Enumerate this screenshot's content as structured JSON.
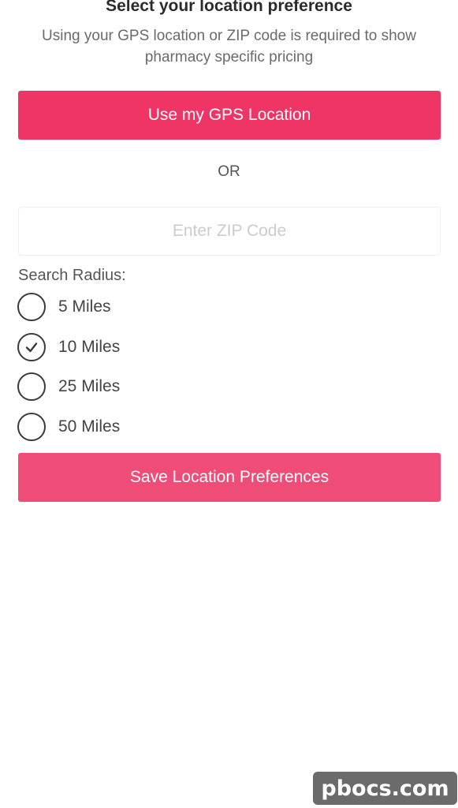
{
  "header": {
    "title": "Select your location preference",
    "subtitle": "Using your GPS location or ZIP code is required to show pharmacy specific pricing"
  },
  "gps_button": {
    "label": "Use my GPS Location",
    "color": "#ee3566"
  },
  "divider_text": "OR",
  "zip": {
    "value": "",
    "placeholder": "Enter ZIP Code"
  },
  "radius": {
    "label": "Search Radius:",
    "options": [
      {
        "label": "5 Miles",
        "selected": false
      },
      {
        "label": "10 Miles",
        "selected": true
      },
      {
        "label": "25 Miles",
        "selected": false
      },
      {
        "label": "50 Miles",
        "selected": false
      }
    ]
  },
  "save_button": {
    "label": "Save Location Preferences",
    "color": "#f04c78"
  },
  "watermark": {
    "text": "pbocs.com"
  }
}
